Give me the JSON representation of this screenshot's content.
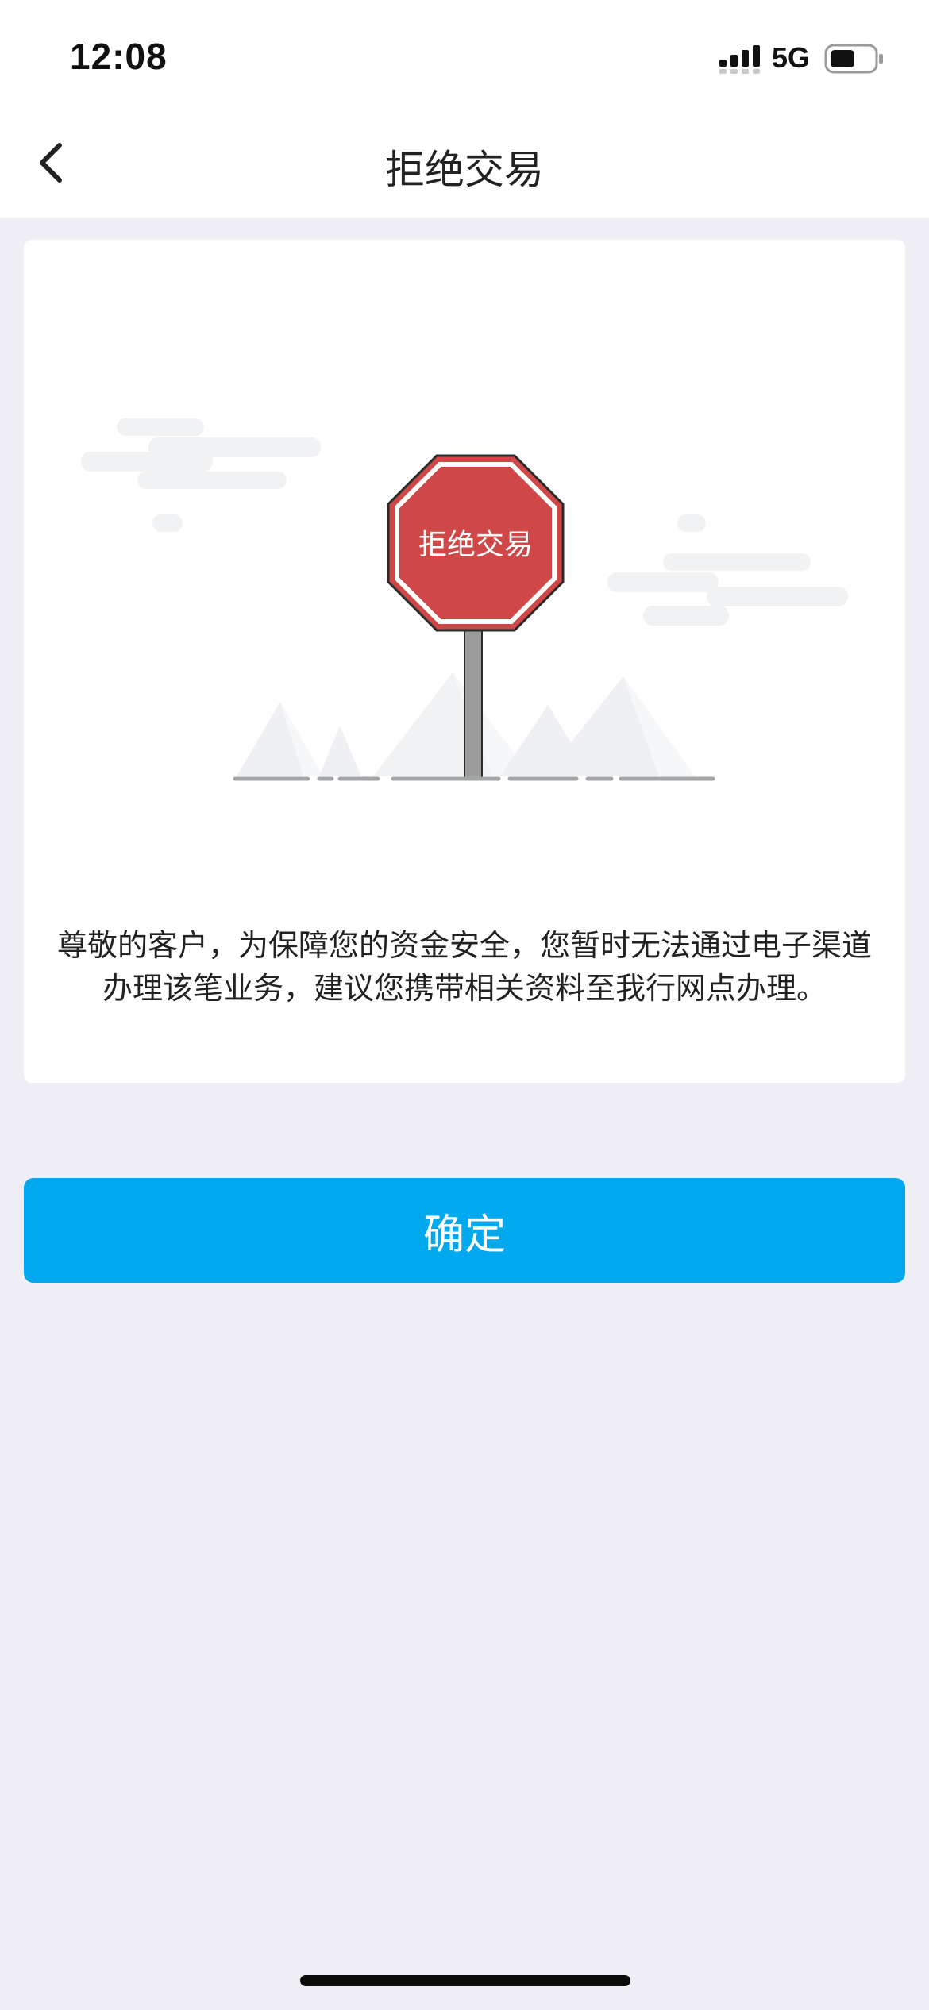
{
  "status_bar": {
    "time": "12:08",
    "network": "5G",
    "icons": [
      "signal-bars-icon",
      "battery-icon"
    ]
  },
  "nav": {
    "back_icon": "chevron-left-icon",
    "title": "拒绝交易"
  },
  "illustration": {
    "sign_text": "拒绝交易",
    "sign_color": "#cf4747"
  },
  "message": {
    "line1": "尊敬的客户，为保障您的资金安全，您暂时无法通过电子渠道",
    "line2": "办理该笔业务，建议您携带相关资料至我行网点办理。"
  },
  "actions": {
    "confirm_label": "确定",
    "confirm_color": "#00a9ee"
  }
}
